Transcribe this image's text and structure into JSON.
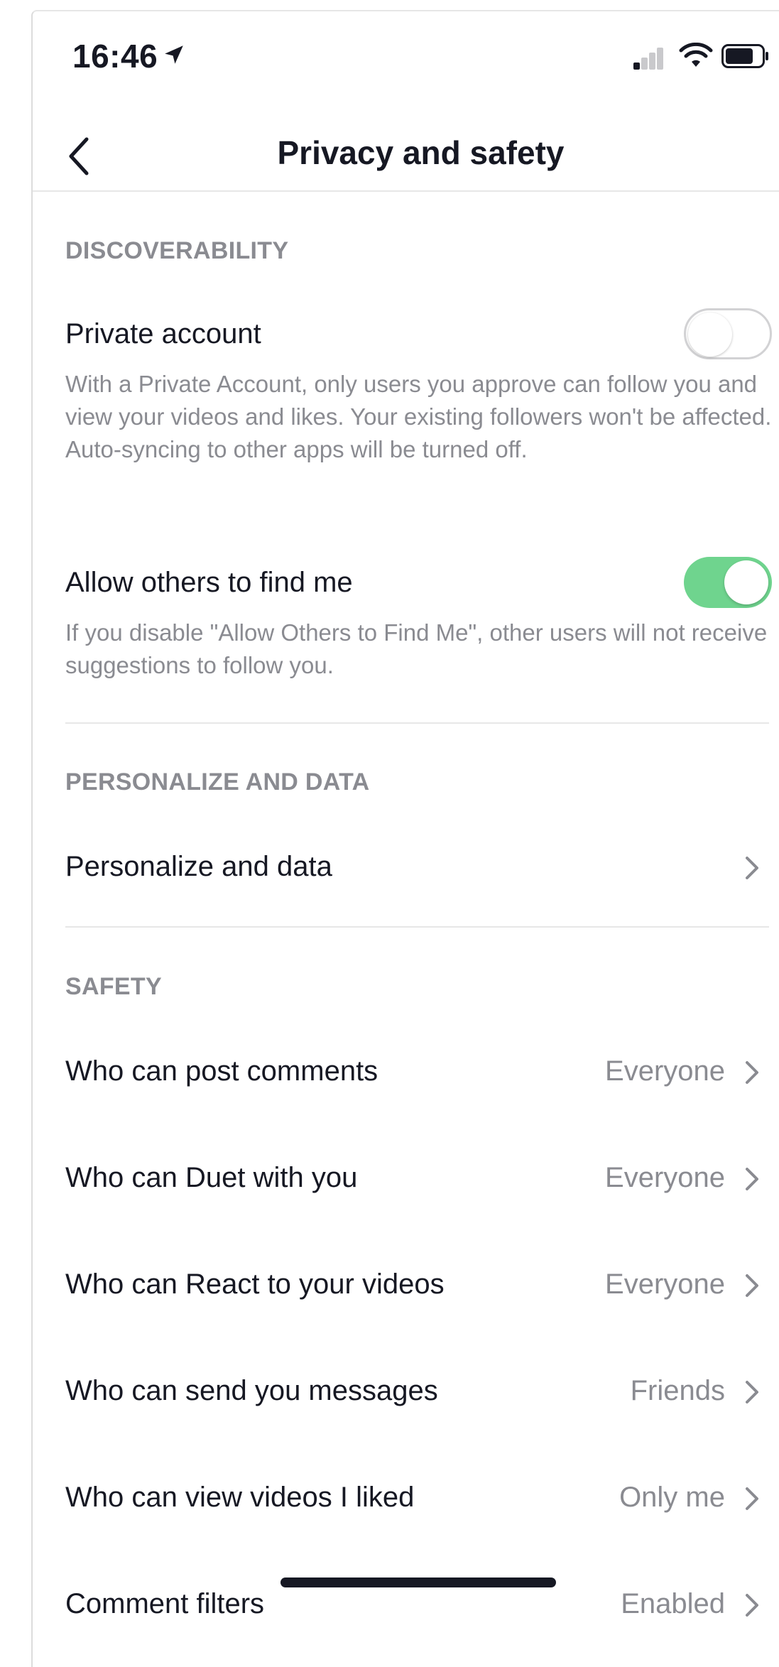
{
  "status_bar": {
    "time": "16:46"
  },
  "header": {
    "title": "Privacy and safety"
  },
  "discoverability": {
    "header": "DISCOVERABILITY",
    "private_account": {
      "label": "Private account",
      "enabled": false,
      "description": "With a Private Account, only users you approve can follow you and view your videos and likes. Your existing followers won't be affected. Auto-syncing to other apps will be turned off."
    },
    "find_me": {
      "label": "Allow others to find me",
      "enabled": true,
      "description": "If you disable \"Allow Others to Find Me\", other users will not receive suggestions to follow you."
    }
  },
  "personalize": {
    "header": "PERSONALIZE AND DATA",
    "item_label": "Personalize and data"
  },
  "safety": {
    "header": "SAFETY",
    "items": [
      {
        "label": "Who can post comments",
        "value": "Everyone"
      },
      {
        "label": "Who can Duet with you",
        "value": "Everyone"
      },
      {
        "label": "Who can React to your videos",
        "value": "Everyone"
      },
      {
        "label": "Who can send you messages",
        "value": "Friends"
      },
      {
        "label": "Who can view videos I liked",
        "value": "Only me"
      },
      {
        "label": "Comment filters",
        "value": "Enabled"
      }
    ]
  },
  "colors": {
    "toggle_on": "#6fd48e",
    "text_primary": "#161823",
    "text_secondary": "#8a8b91"
  }
}
